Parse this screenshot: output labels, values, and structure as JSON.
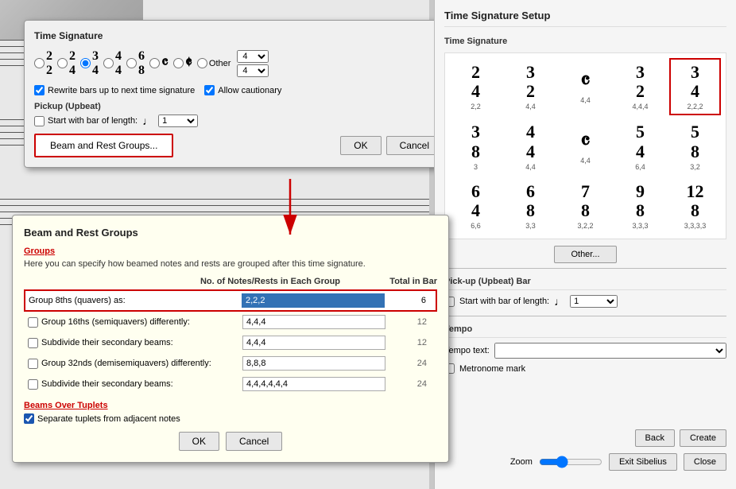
{
  "music_bg": {
    "description": "Music notation background"
  },
  "time_sig_dialog": {
    "title": "Time Signature",
    "options": [
      {
        "label": "2/2",
        "top": "2",
        "bottom": "2",
        "selected": false
      },
      {
        "label": "2/4",
        "top": "2",
        "bottom": "4",
        "selected": false
      },
      {
        "label": "3/4",
        "top": "3",
        "bottom": "4",
        "selected": true
      },
      {
        "label": "4/4",
        "top": "4",
        "bottom": "4",
        "selected": false
      },
      {
        "label": "6/8",
        "top": "6",
        "bottom": "8",
        "selected": false
      },
      {
        "label": "C",
        "symbol": "C",
        "selected": false
      },
      {
        "label": "Cut-C",
        "symbol": "¢",
        "selected": false
      },
      {
        "label": "Other",
        "selected": false
      }
    ],
    "other_top": "4",
    "other_bottom": "4",
    "rewrite_bars": true,
    "rewrite_label": "Rewrite bars up to next time signature",
    "allow_cautionary": true,
    "allow_cautionary_label": "Allow cautionary",
    "pickup_label": "Pickup (Upbeat)",
    "start_with_bar": false,
    "start_with_bar_label": "Start with bar of length:",
    "beam_rest_btn": "Beam and Rest Groups...",
    "ok": "OK",
    "cancel": "Cancel"
  },
  "beam_dialog": {
    "title": "Beam and Rest Groups",
    "groups_label": "Groups",
    "description": "Here you can specify how beamed notes and rests are grouped after this time signature.",
    "col_notes": "No. of Notes/Rests in Each Group",
    "col_total": "Total in Bar",
    "rows": [
      {
        "label": "Group 8ths (quavers) as:",
        "value": "2,2,2",
        "total": "6",
        "highlighted": true,
        "checkbox": false
      },
      {
        "label": "Group 16ths (semiquavers) differently:",
        "value": "4,4,4",
        "total": "12",
        "highlighted": false,
        "checkbox": true,
        "checked": false
      },
      {
        "label": "Subdivide their secondary beams:",
        "value": "4,4,4",
        "total": "12",
        "highlighted": false,
        "checkbox": true,
        "checked": false
      },
      {
        "label": "Group 32nds (demisemiquavers) differently:",
        "value": "8,8,8",
        "total": "24",
        "highlighted": false,
        "checkbox": true,
        "checked": false
      },
      {
        "label": "Subdivide their secondary beams:",
        "value": "4,4,4,4,4,4",
        "total": "24",
        "highlighted": false,
        "checkbox": true,
        "checked": false
      }
    ],
    "beams_over_tuplets": "Beams Over Tuplets",
    "separate_tuplets": true,
    "separate_tuplets_label": "Separate tuplets from adjacent notes",
    "ok": "OK",
    "cancel": "Cancel"
  },
  "right_panel": {
    "title": "Time Signature Setup",
    "ts_section": "Time Signature",
    "time_signatures": [
      {
        "top": "2",
        "bottom": "4",
        "label": "2,2",
        "selected": false,
        "row": 0
      },
      {
        "top": "3",
        "bottom": "2",
        "label": "4,4",
        "selected": false,
        "row": 0
      },
      {
        "symbol": "C",
        "label": "4,4",
        "selected": false,
        "row": 0
      },
      {
        "top": "3",
        "bottom": "2",
        "label": "4,4,4",
        "selected": false,
        "row": 0
      },
      {
        "top": "3",
        "bottom": "4",
        "label": "2,2,2",
        "selected": true,
        "row": 0
      },
      {
        "top": "3",
        "bottom": "8",
        "label": "3",
        "selected": false,
        "row": 1
      },
      {
        "top": "4",
        "bottom": "4",
        "label": "4,4",
        "selected": false,
        "row": 1
      },
      {
        "symbol": "C",
        "label": "4,4",
        "selected": false,
        "row": 1
      },
      {
        "top": "5",
        "bottom": "4",
        "label": "6,4",
        "selected": false,
        "row": 1
      },
      {
        "top": "5",
        "bottom": "8",
        "label": "3,2",
        "selected": false,
        "row": 1
      },
      {
        "top": "6",
        "bottom": "4",
        "label": "6,6",
        "selected": false,
        "row": 2
      },
      {
        "top": "6",
        "bottom": "8",
        "label": "3,3",
        "selected": false,
        "row": 2
      },
      {
        "top": "7",
        "bottom": "8",
        "label": "3,2,2",
        "selected": false,
        "row": 2
      },
      {
        "top": "9",
        "bottom": "8",
        "label": "3,3,3",
        "selected": false,
        "row": 2
      },
      {
        "top": "12",
        "bottom": "8",
        "label": "3,3,3,3",
        "selected": false,
        "row": 2
      }
    ],
    "other_btn": "Other...",
    "pickup_section": "Pick-up (Upbeat) Bar",
    "start_bar_label": "Start with bar of length:",
    "note_symbol": "♩",
    "tempo_section": "Tempo",
    "tempo_text_label": "Tempo text:",
    "metronome_label": "Metronome mark",
    "back_btn": "Back",
    "create_btn": "Create",
    "zoom_label": "Zoom",
    "exit_btn": "Exit Sibelius",
    "close_btn": "Close"
  }
}
